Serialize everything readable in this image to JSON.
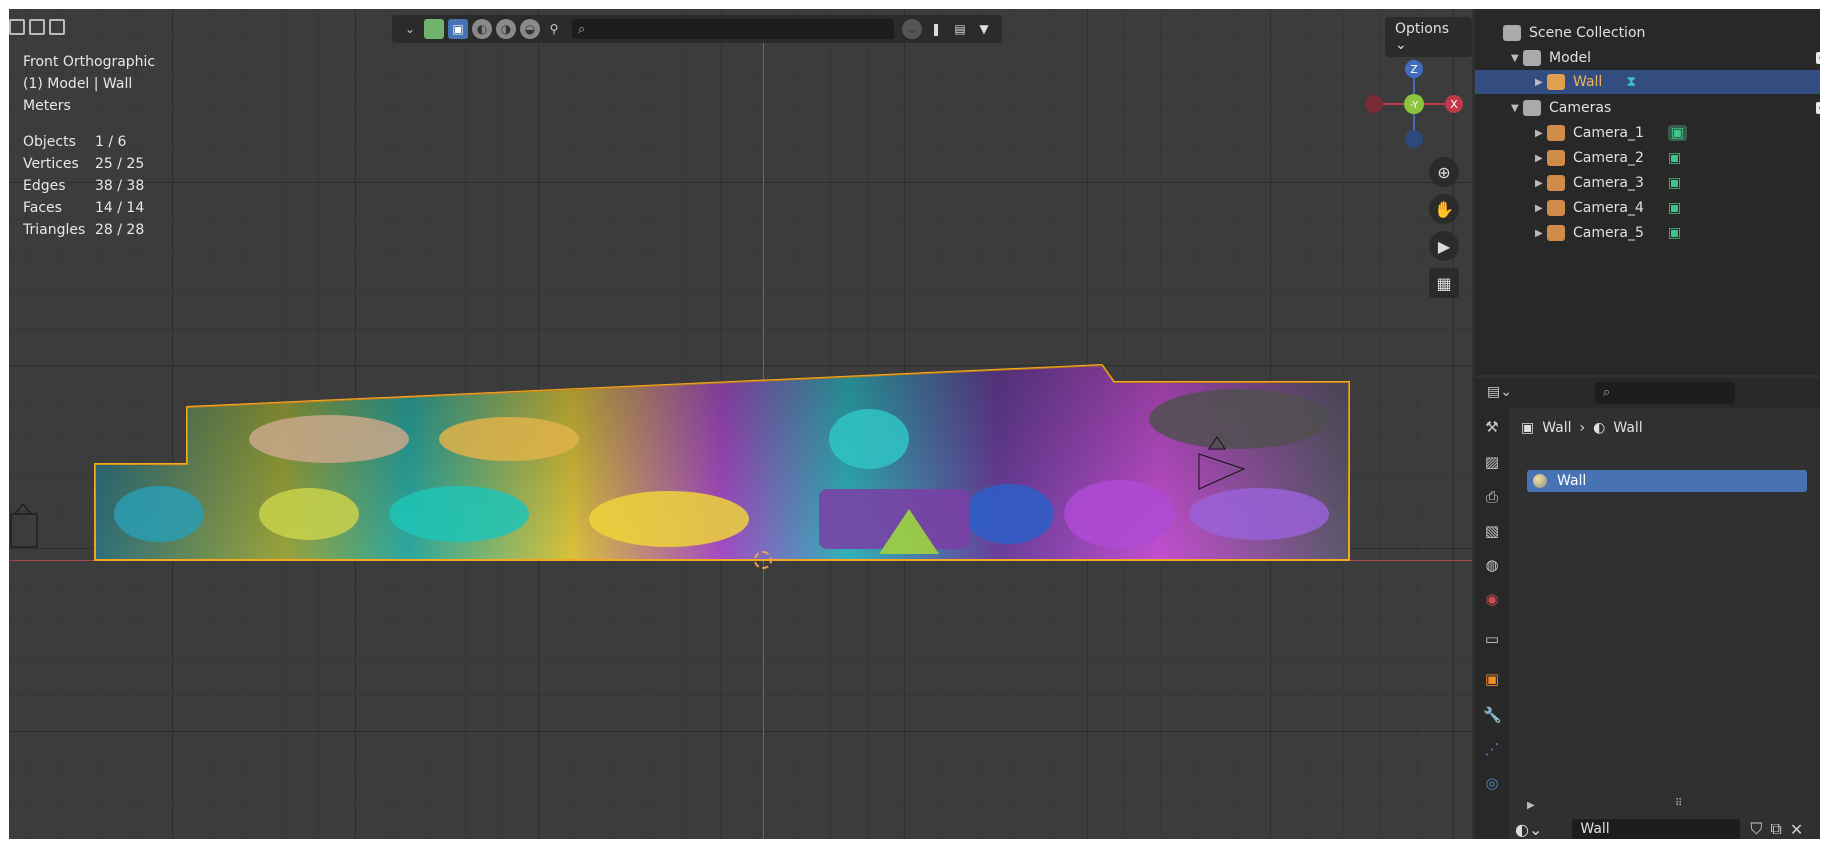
{
  "viewport": {
    "view_name": "Front Orthographic",
    "context": "(1) Model | Wall",
    "units": "Meters",
    "stats": [
      {
        "label": "Objects",
        "value": "1 / 6"
      },
      {
        "label": "Vertices",
        "value": "25 / 25"
      },
      {
        "label": "Edges",
        "value": "38 / 38"
      },
      {
        "label": "Faces",
        "value": "14 / 14"
      },
      {
        "label": "Triangles",
        "value": "28 / 28"
      }
    ],
    "options_label": "Options",
    "gizmo": {
      "z": "Z",
      "y": "-Y",
      "x": "X"
    },
    "search_icon": "search-icon"
  },
  "outliner": {
    "title": "Scene Collection",
    "rows": [
      {
        "label": "Model"
      },
      {
        "label": "Wall"
      },
      {
        "label": "Cameras"
      },
      {
        "label": "Camera_1"
      },
      {
        "label": "Camera_2"
      },
      {
        "label": "Camera_3"
      },
      {
        "label": "Camera_4"
      },
      {
        "label": "Camera_5"
      }
    ]
  },
  "properties": {
    "breadcrumb_object": "Wall",
    "breadcrumb_material": "Wall",
    "material_slot": "Wall",
    "material_name": "Wall"
  },
  "colors": {
    "selection": "#334d80",
    "active_blue": "#4772b3",
    "object_outline": "#f5a623",
    "x_axis": "#a3474f",
    "z_axis": "#3f6dbb"
  }
}
